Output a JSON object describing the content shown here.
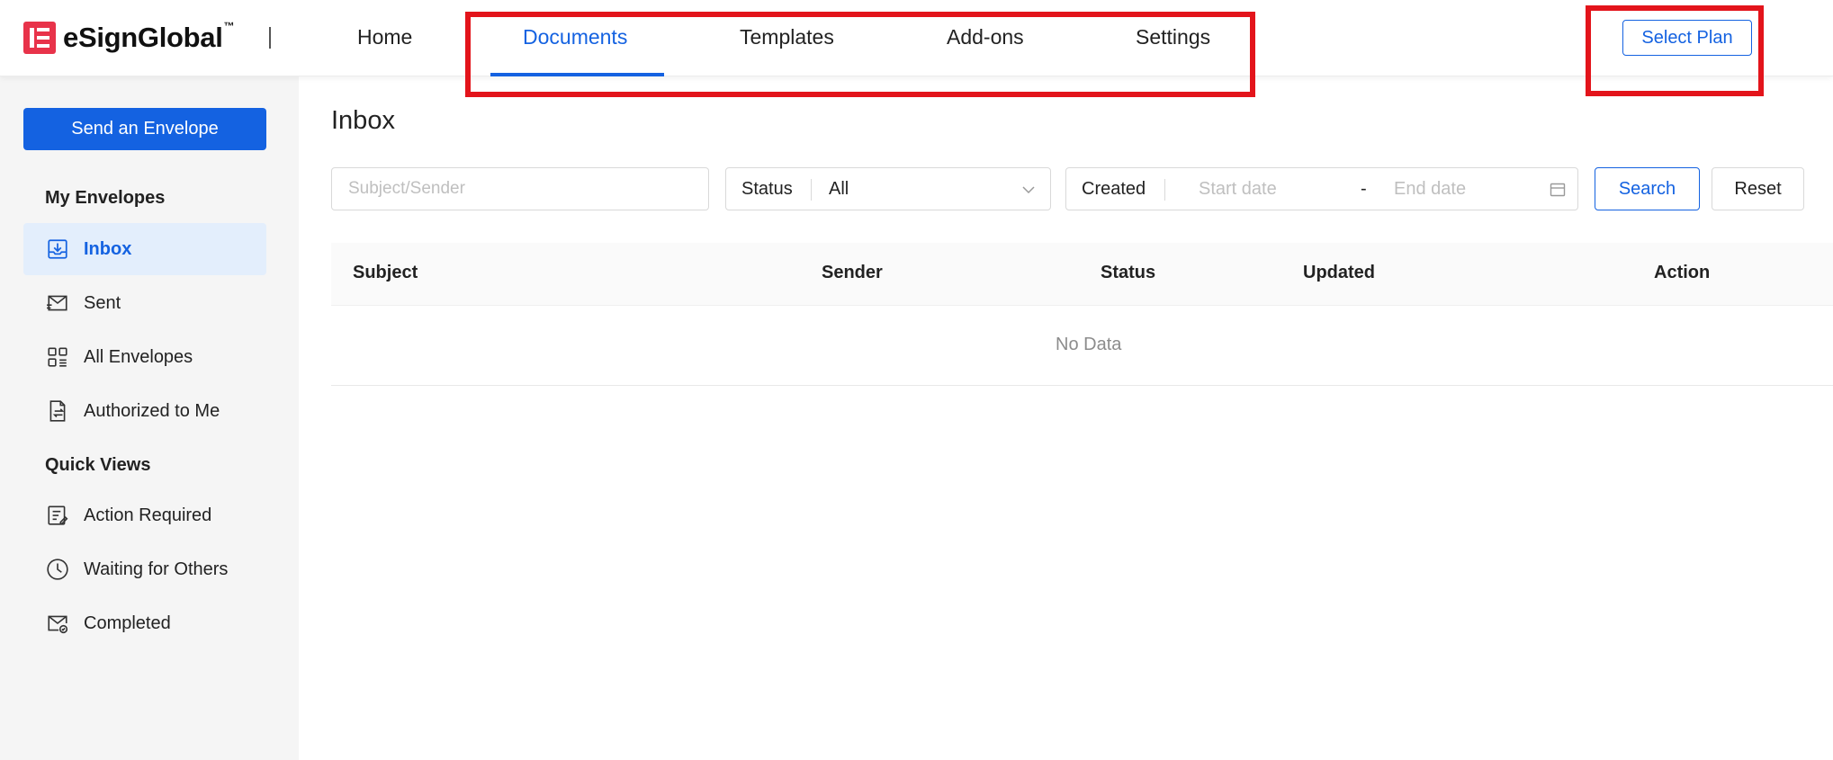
{
  "brand": {
    "name": "eSignGlobal",
    "trademark": "™",
    "color": "#e8334a"
  },
  "nav": {
    "items": [
      {
        "label": "Home",
        "active": false
      },
      {
        "label": "Documents",
        "active": true
      },
      {
        "label": "Templates",
        "active": false
      },
      {
        "label": "Add-ons",
        "active": false
      },
      {
        "label": "Settings",
        "active": false
      }
    ],
    "select_plan_label": "Select Plan"
  },
  "sidebar": {
    "send_button_label": "Send an Envelope",
    "my_envelopes": {
      "title": "My Envelopes",
      "items": [
        {
          "label": "Inbox",
          "icon": "inbox-icon",
          "active": true
        },
        {
          "label": "Sent",
          "icon": "sent-envelope-icon",
          "active": false
        },
        {
          "label": "All Envelopes",
          "icon": "grid-list-icon",
          "active": false
        },
        {
          "label": "Authorized to Me",
          "icon": "document-transfer-icon",
          "active": false
        }
      ]
    },
    "quick_views": {
      "title": "Quick Views",
      "items": [
        {
          "label": "Action Required",
          "icon": "edit-list-icon"
        },
        {
          "label": "Waiting for Others",
          "icon": "clock-icon"
        },
        {
          "label": "Completed",
          "icon": "envelope-check-icon"
        }
      ]
    }
  },
  "main": {
    "title": "Inbox",
    "filters": {
      "subject_placeholder": "Subject/Sender",
      "status_label": "Status",
      "status_value": "All",
      "created_label": "Created",
      "start_placeholder": "Start date",
      "range_separator": "-",
      "end_placeholder": "End date",
      "search_label": "Search",
      "reset_label": "Reset"
    },
    "table": {
      "columns": [
        "Subject",
        "Sender",
        "Status",
        "Updated",
        "Action"
      ],
      "empty_text": "No Data"
    }
  },
  "colors": {
    "accent": "#1462e1",
    "highlight": "#e3141b",
    "active_bg": "#e3eefc"
  }
}
